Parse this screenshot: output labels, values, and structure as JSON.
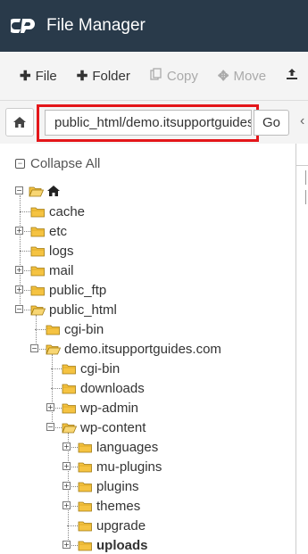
{
  "app": {
    "title": "File Manager",
    "logo": "cpanel-logo"
  },
  "toolbar": {
    "file": {
      "label": "File",
      "icon": "plus-icon"
    },
    "folder": {
      "label": "Folder",
      "icon": "plus-icon"
    },
    "copy": {
      "label": "Copy",
      "icon": "copy-icon"
    },
    "move": {
      "label": "Move",
      "icon": "move-icon"
    },
    "upload": {
      "icon": "upload-icon"
    }
  },
  "pathbar": {
    "path": "public_html/demo.itsupportguides.com",
    "go_label": "Go"
  },
  "tree": {
    "collapse_all": "Collapse All",
    "nodes": [
      {
        "label": "cache"
      },
      {
        "label": "etc"
      },
      {
        "label": "logs"
      },
      {
        "label": "mail"
      },
      {
        "label": "public_ftp"
      },
      {
        "label": "public_html"
      },
      {
        "label": "cgi-bin"
      },
      {
        "label": "demo.itsupportguides.com"
      },
      {
        "label": "cgi-bin"
      },
      {
        "label": "downloads"
      },
      {
        "label": "wp-admin"
      },
      {
        "label": "wp-content"
      },
      {
        "label": "languages"
      },
      {
        "label": "mu-plugins"
      },
      {
        "label": "plugins"
      },
      {
        "label": "themes"
      },
      {
        "label": "upgrade"
      },
      {
        "label": "uploads"
      }
    ]
  },
  "colors": {
    "titlebar": "#293a4a",
    "highlight": "#e4161a",
    "folder": "#f5c342"
  }
}
